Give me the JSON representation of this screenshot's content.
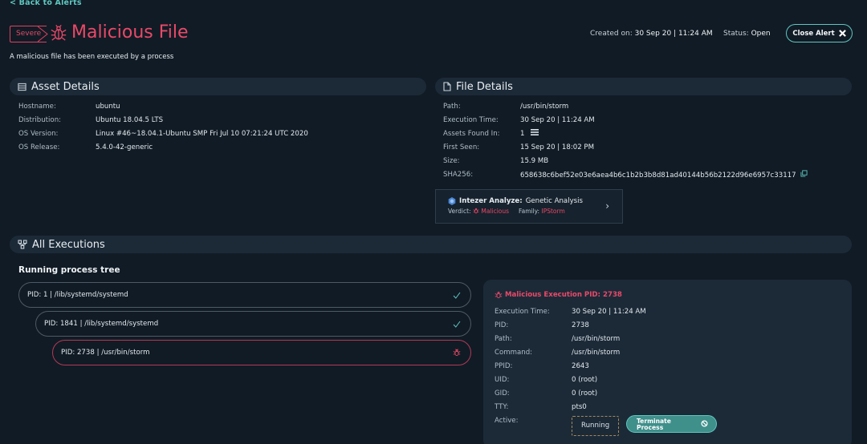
{
  "nav": {
    "back_label": "< Back to Alerts"
  },
  "alert": {
    "severity": "Severe",
    "title": "Malicious File",
    "description": "A malicious file has been executed by a process",
    "created_label": "Created on:",
    "created_value": "30 Sep 20 | 11:24 AM",
    "status_label": "Status:",
    "status_value": "Open",
    "close_label": "Close Alert"
  },
  "asset": {
    "heading": "Asset Details",
    "rows": [
      {
        "k": "Hostname:",
        "v": "ubuntu"
      },
      {
        "k": "Distribution:",
        "v": "Ubuntu 18.04.5 LTS"
      },
      {
        "k": "OS Version:",
        "v": "Linux #46~18.04.1-Ubuntu SMP Fri Jul 10 07:21:24 UTC 2020"
      },
      {
        "k": "OS Release:",
        "v": "5.4.0-42-generic"
      }
    ]
  },
  "file": {
    "heading": "File Details",
    "rows": [
      {
        "k": "Path:",
        "v": "/usr/bin/storm"
      },
      {
        "k": "Execution Time:",
        "v": "30 Sep 20 | 11:24 AM"
      },
      {
        "k": "Assets Found In:",
        "v": "1"
      },
      {
        "k": "First Seen:",
        "v": "15 Sep 20 | 18:02 PM"
      },
      {
        "k": "Size:",
        "v": "15.9 MB"
      },
      {
        "k": "SHA256:",
        "v": "658638c6bef52e03e6aea4b6c1b2b3b8d81ad40144b56b2122d96e6957c33117"
      }
    ],
    "intezer": {
      "brand": "Intezer Analyze:",
      "mode": "Genetic Analysis",
      "verdict_label": "Verdict:",
      "verdict_value": "Malicious",
      "family_label": "Family:",
      "family_value": "IPStorm"
    }
  },
  "executions": {
    "heading": "All Executions",
    "tree_title": "Running process tree",
    "tree": [
      {
        "label": "PID: 1  |  /lib/systemd/systemd",
        "status": "ok"
      },
      {
        "label": "PID: 1841  |  /lib/systemd/systemd",
        "status": "ok"
      },
      {
        "label": "PID: 2738  |  /usr/bin/storm",
        "status": "malicious"
      }
    ],
    "detail": {
      "title": "Malicious Execution PID: 2738",
      "rows": [
        {
          "k": "Execution Time:",
          "v": "30 Sep 20 | 11:24 AM"
        },
        {
          "k": "PID:",
          "v": "2738"
        },
        {
          "k": "Path:",
          "v": "/usr/bin/storm"
        },
        {
          "k": "Command:",
          "v": "/usr/bin/storm"
        },
        {
          "k": "PPID:",
          "v": "2643"
        },
        {
          "k": "UID:",
          "v": "0 (root)"
        },
        {
          "k": "GID:",
          "v": "0 (root)"
        },
        {
          "k": "TTY:",
          "v": "pts0"
        }
      ],
      "active_label": "Active:",
      "active_value": "Running",
      "terminate_label_1": "Terminate",
      "terminate_label_2": "Process"
    }
  },
  "colors": {
    "accent": "#5fc7c0",
    "danger": "#ea4968",
    "panel": "#1c2a38",
    "background": "#111b25"
  }
}
